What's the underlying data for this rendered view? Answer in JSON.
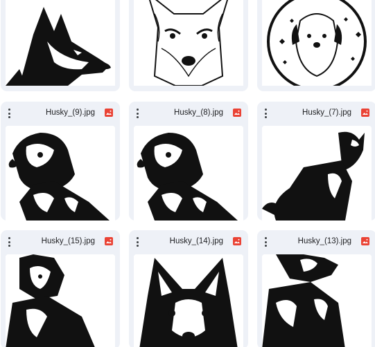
{
  "files": [
    {
      "name": "",
      "type": "image"
    },
    {
      "name": "",
      "type": "image"
    },
    {
      "name": "",
      "type": "image"
    },
    {
      "name": "Husky_(9).jpg",
      "type": "image"
    },
    {
      "name": "Husky_(8).jpg",
      "type": "image"
    },
    {
      "name": "Husky_(7).jpg",
      "type": "image"
    },
    {
      "name": "Husky_(15).jpg",
      "type": "image"
    },
    {
      "name": "Husky_(14).jpg",
      "type": "image"
    },
    {
      "name": "Husky_(13).jpg",
      "type": "image"
    }
  ],
  "colors": {
    "card_bg": "#eef1f7",
    "image_icon": "#ea4335",
    "text": "#202124"
  }
}
